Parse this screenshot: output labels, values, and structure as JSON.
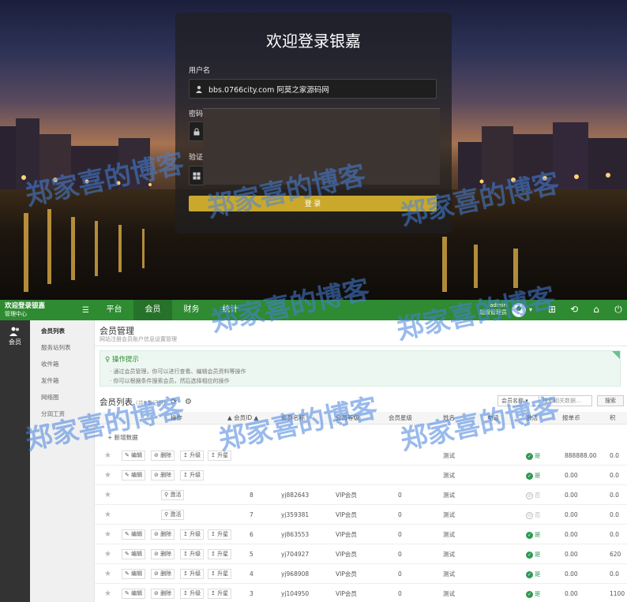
{
  "login": {
    "title": "欢迎登录银嘉",
    "username_label": "用户名",
    "username_value": "bbs.0766city.com  阿莫之家源码网",
    "password_label": "密码",
    "captcha_label": "验证",
    "login_button": "登 录"
  },
  "header": {
    "brand": "欢迎登录银嘉",
    "brand_sub": "管理中心",
    "menu_icon": "hamburger-icon",
    "tabs": [
      {
        "label": "平台",
        "active": false
      },
      {
        "label": "会员",
        "active": true
      },
      {
        "label": "财务",
        "active": false
      },
      {
        "label": "统计",
        "active": false
      }
    ],
    "user_name": "admin",
    "user_role": "超级管理员"
  },
  "leftrail": {
    "label": "会员"
  },
  "subnav": {
    "items": [
      "会员列表",
      "服务站列表",
      "收件箱",
      "发件箱",
      "网络图",
      "分润工资"
    ]
  },
  "page": {
    "title": "会员管理",
    "subtitle": "网站注册会员账户信息设置管理",
    "tips_title": "操作提示",
    "tips": [
      "通过会员管理，你可以进行查看、编辑会员资料等操作",
      "你可以根据条件搜索会员，然后选择相应的操作"
    ],
    "list_title": "会员列表",
    "list_count": "(共9条记录)",
    "search_select": "会员名称",
    "search_placeholder": "搜索相关数据...",
    "search_button": "搜索",
    "add_label": "+ 新增数据"
  },
  "table": {
    "headers": [
      "操作",
      "会员ID",
      "会员名称",
      "会员等级",
      "会员星级",
      "姓名",
      "电话",
      "激活",
      "报单币",
      "积"
    ],
    "action_labels": {
      "edit": "编辑",
      "delete": "删除",
      "upgrade": "升级",
      "star": "升星",
      "activate": "激活"
    },
    "rows": [
      {
        "actions": "edit-delete-upgrade-star",
        "id": "",
        "name": "",
        "level": "",
        "stars": "",
        "realname": "测试",
        "active": "是",
        "is_active": true,
        "coin": "888888.00",
        "extra": "0.0"
      },
      {
        "actions": "edit-delete-upgrade-star",
        "id": "",
        "name": "",
        "level": "",
        "stars": "",
        "realname": "测试",
        "active": "是",
        "is_active": true,
        "coin": "0.00",
        "extra": "0.0"
      },
      {
        "actions": "activate",
        "id": "8",
        "name": "yj882643",
        "level": "VIP会员",
        "stars": "0",
        "realname": "测试",
        "active": "否",
        "is_active": false,
        "coin": "0.00",
        "extra": "0.0"
      },
      {
        "actions": "activate",
        "id": "7",
        "name": "yj359381",
        "level": "VIP会员",
        "stars": "0",
        "realname": "测试",
        "active": "否",
        "is_active": false,
        "coin": "0.00",
        "extra": "0.0"
      },
      {
        "actions": "edit-delete-upgrade-star",
        "id": "6",
        "name": "yj863553",
        "level": "VIP会员",
        "stars": "0",
        "realname": "测试",
        "active": "是",
        "is_active": true,
        "coin": "0.00",
        "extra": "0.0"
      },
      {
        "actions": "edit-delete-upgrade-star",
        "id": "5",
        "name": "yj704927",
        "level": "VIP会员",
        "stars": "0",
        "realname": "测试",
        "active": "是",
        "is_active": true,
        "coin": "0.00",
        "extra": "620"
      },
      {
        "actions": "edit-delete-upgrade-star",
        "id": "4",
        "name": "yj968908",
        "level": "VIP会员",
        "stars": "0",
        "realname": "测试",
        "active": "是",
        "is_active": true,
        "coin": "0.00",
        "extra": "0.0"
      },
      {
        "actions": "edit-delete-upgrade-star",
        "id": "3",
        "name": "yj104950",
        "level": "VIP会员",
        "stars": "0",
        "realname": "测试",
        "active": "是",
        "is_active": true,
        "coin": "0.00",
        "extra": "1100"
      }
    ]
  },
  "watermark": "郑家喜的博客",
  "colors": {
    "header_green": "#2e8b31",
    "accent_gold": "#c9a82c",
    "active_green": "#2e9a52"
  }
}
